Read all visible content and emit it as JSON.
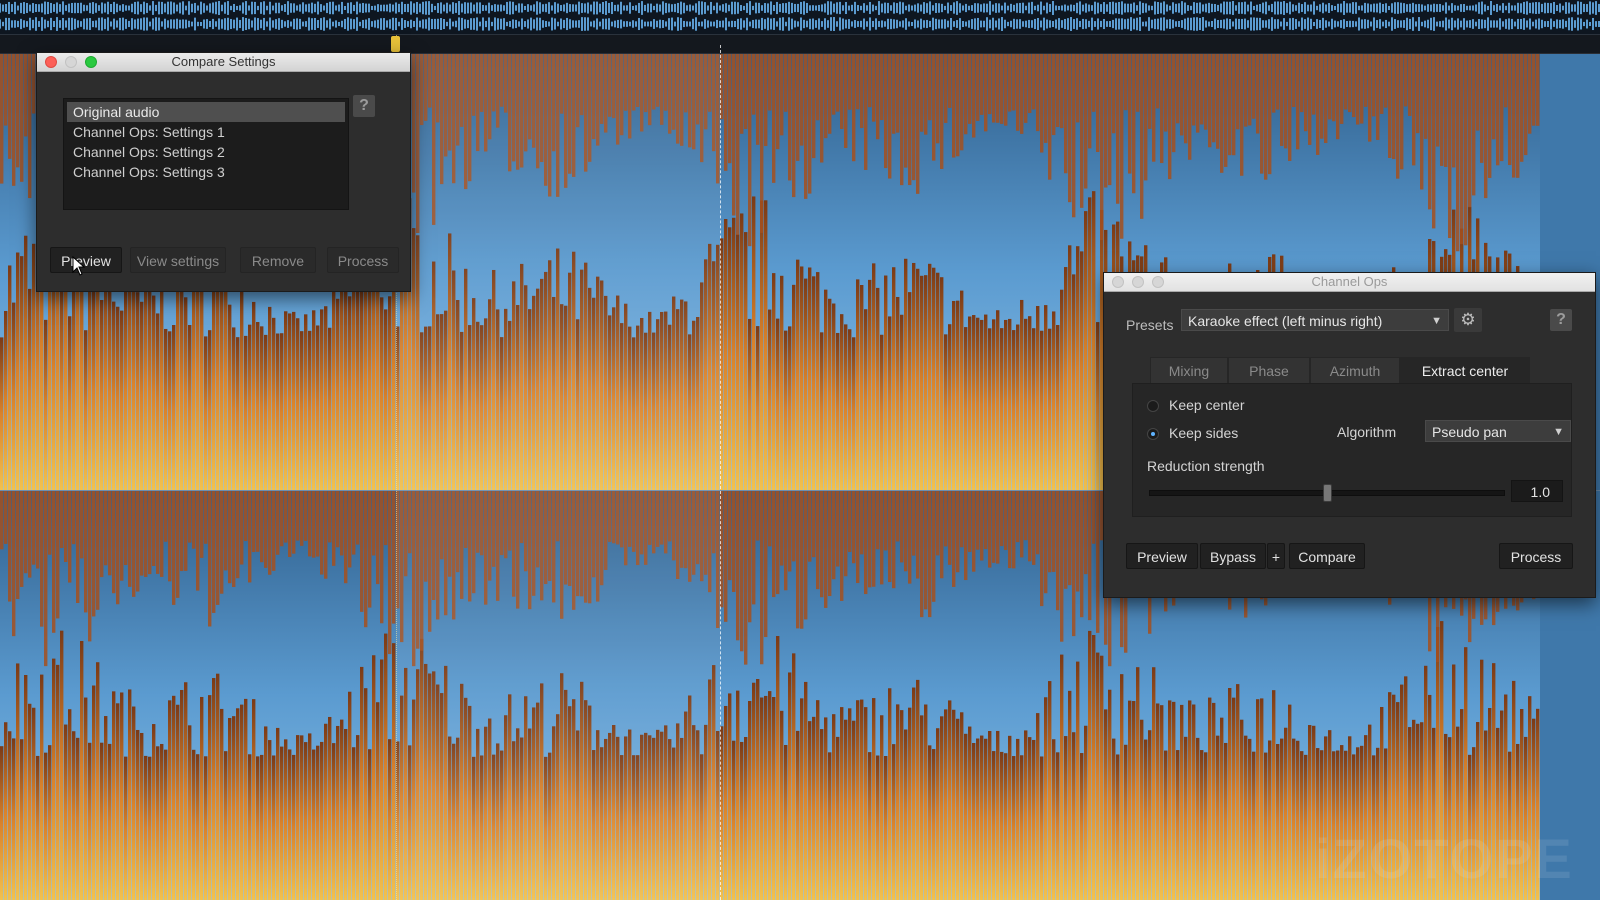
{
  "compare_settings": {
    "title": "Compare Settings",
    "help": "?",
    "items": [
      "Original audio",
      "Channel Ops: Settings 1",
      "Channel Ops: Settings 2",
      "Channel Ops: Settings 3"
    ],
    "buttons": {
      "preview": "Preview",
      "view_settings": "View settings",
      "remove": "Remove",
      "process": "Process"
    }
  },
  "channel_ops": {
    "title": "Channel Ops",
    "presets_label": "Presets",
    "preset_value": "Karaoke effect (left minus right)",
    "help": "?",
    "tabs": [
      "Mixing",
      "Phase",
      "Azimuth",
      "Extract center"
    ],
    "active_tab": "Extract center",
    "keep_center": "Keep center",
    "keep_sides": "Keep sides",
    "selected_mode": "Keep sides",
    "algorithm_label": "Algorithm",
    "algorithm_value": "Pseudo pan",
    "reduction_label": "Reduction strength",
    "reduction_value": "1.0",
    "reduction_fraction": 0.5,
    "buttons": {
      "preview": "Preview",
      "bypass": "Bypass",
      "plus": "+",
      "compare": "Compare",
      "process": "Process"
    }
  },
  "colors": {
    "spectrogram_blue": "#5b9bd0",
    "spectrogram_orange": "#d9822b",
    "spectrogram_yellow": "#f2c14e",
    "radio_accent": "#5fb3ff"
  }
}
